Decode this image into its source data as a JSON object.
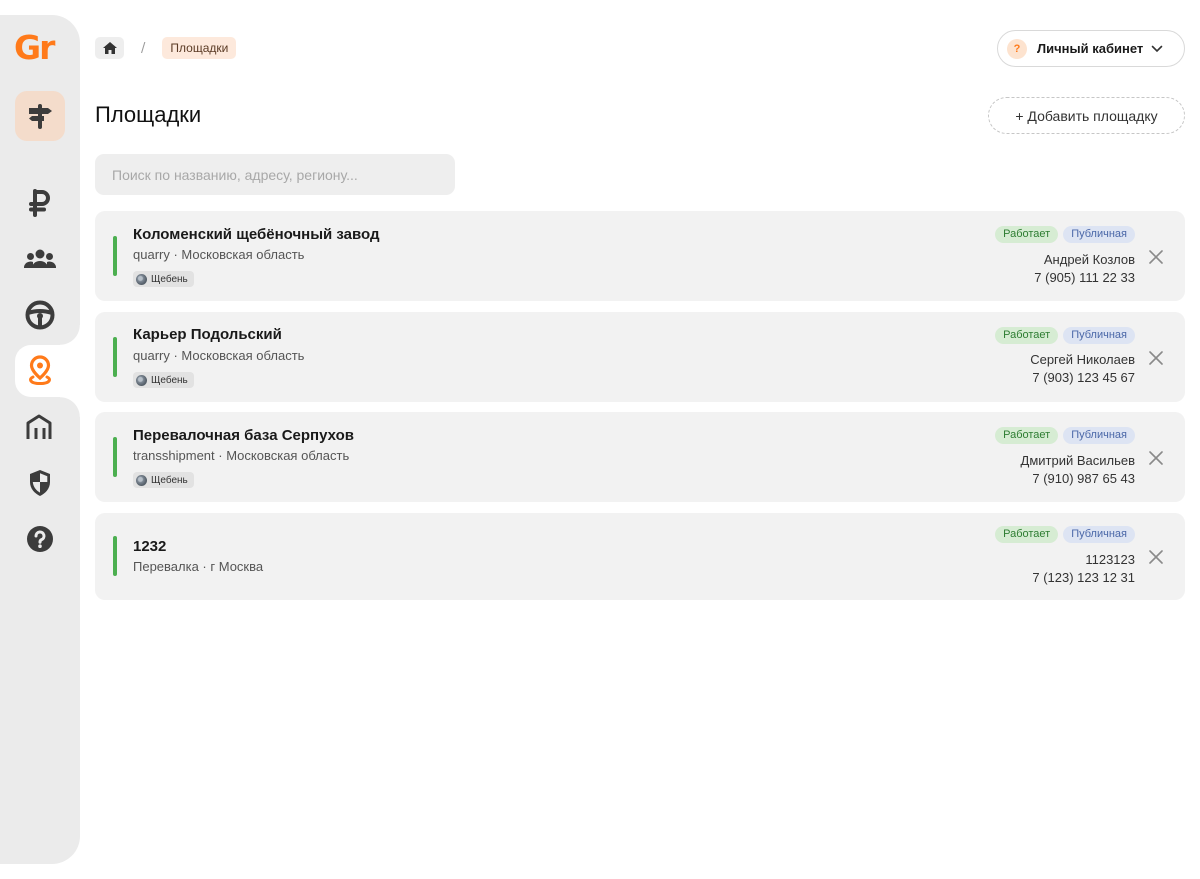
{
  "sidebar": {
    "logo": "Gr",
    "items": [
      {
        "name": "ruble-icon"
      },
      {
        "name": "users-icon"
      },
      {
        "name": "steering-wheel-icon"
      },
      {
        "name": "location-pin-icon",
        "active": true
      },
      {
        "name": "warehouse-icon"
      },
      {
        "name": "shield-icon"
      },
      {
        "name": "help-icon"
      }
    ]
  },
  "breadcrumb": {
    "separator": "/",
    "current": "Площадки"
  },
  "account": {
    "icon_char": "?",
    "label": "Личный кабинет"
  },
  "page": {
    "title": "Площадки",
    "add_button": "+ Добавить площадку"
  },
  "search": {
    "placeholder": "Поиск по названию, адресу, региону...",
    "value": ""
  },
  "colors": {
    "accent": "#ff7a1a",
    "status_bar": "#4caf50",
    "badge_green_bg": "#d6ecd3",
    "badge_blue_bg": "#dde4f3"
  },
  "sites": [
    {
      "name": "Коломенский щебёночный завод",
      "subtitle": "quarry · Московская область",
      "tag": "Щебень",
      "status": "Работает",
      "visibility": "Публичная",
      "contact_name": "Андрей Козлов",
      "contact_phone": "7 (905) 111 22 33"
    },
    {
      "name": "Карьер Подольский",
      "subtitle": "quarry · Московская область",
      "tag": "Щебень",
      "status": "Работает",
      "visibility": "Публичная",
      "contact_name": "Сергей Николаев",
      "contact_phone": "7 (903) 123 45 67"
    },
    {
      "name": "Перевалочная база Серпухов",
      "subtitle": "transshipment · Московская область",
      "tag": "Щебень",
      "status": "Работает",
      "visibility": "Публичная",
      "contact_name": "Дмитрий Васильев",
      "contact_phone": "7 (910) 987 65 43"
    },
    {
      "name": "1232",
      "subtitle": "Перевалка · г Москва",
      "status": "Работает",
      "visibility": "Публичная",
      "contact_name": "1123123",
      "contact_phone": "7 (123) 123 12 31"
    }
  ]
}
